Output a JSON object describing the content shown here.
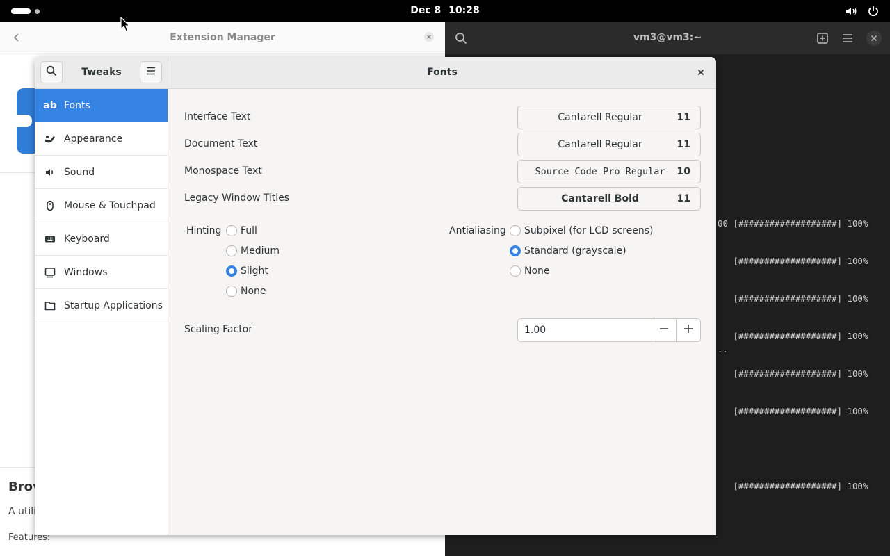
{
  "topbar": {
    "date": "Dec 8",
    "time": "10:28"
  },
  "extension_manager": {
    "title": "Extension Manager",
    "heading": "Brov",
    "description": "A utili",
    "features": "Features:"
  },
  "terminal": {
    "title": "vm3@vm3:~",
    "lines": [
      "00 [###################] 100%",
      "   [###################] 100%",
      "   [###################] 100%",
      "   [###################] 100%",
      "   [###################] 100%",
      "   [###################] 100%",
      "",
      "   [###################] 100%"
    ],
    "dots": ".."
  },
  "tweaks": {
    "sidebar_title": "Tweaks",
    "page_title": "Fonts",
    "sidebar_items": [
      {
        "label": "Fonts",
        "icon": "font-icon",
        "active": true
      },
      {
        "label": "Appearance",
        "icon": "appearance-icon"
      },
      {
        "label": "Sound",
        "icon": "sound-icon"
      },
      {
        "label": "Mouse & Touchpad",
        "icon": "mouse-icon"
      },
      {
        "label": "Keyboard",
        "icon": "keyboard-icon"
      },
      {
        "label": "Windows",
        "icon": "windows-icon"
      },
      {
        "label": "Startup Applications",
        "icon": "folder-icon"
      }
    ],
    "fonts": [
      {
        "label": "Interface Text",
        "font": "Cantarell Regular",
        "size": "11"
      },
      {
        "label": "Document Text",
        "font": "Cantarell Regular",
        "size": "11"
      },
      {
        "label": "Monospace Text",
        "font": "Source Code Pro Regular",
        "size": "10"
      },
      {
        "label": "Legacy Window Titles",
        "font": "Cantarell Bold",
        "size": "11"
      }
    ],
    "hinting": {
      "label": "Hinting",
      "options": [
        "Full",
        "Medium",
        "Slight",
        "None"
      ],
      "selected": "Slight"
    },
    "antialiasing": {
      "label": "Antialiasing",
      "options": [
        "Subpixel (for LCD screens)",
        "Standard (grayscale)",
        "None"
      ],
      "selected": "Standard (grayscale)"
    },
    "scaling": {
      "label": "Scaling Factor",
      "value": "1.00"
    }
  },
  "colors": {
    "accent": "#3584e4",
    "window_bg": "#f6f5f4",
    "terminal_bg": "#1e1e1e"
  }
}
